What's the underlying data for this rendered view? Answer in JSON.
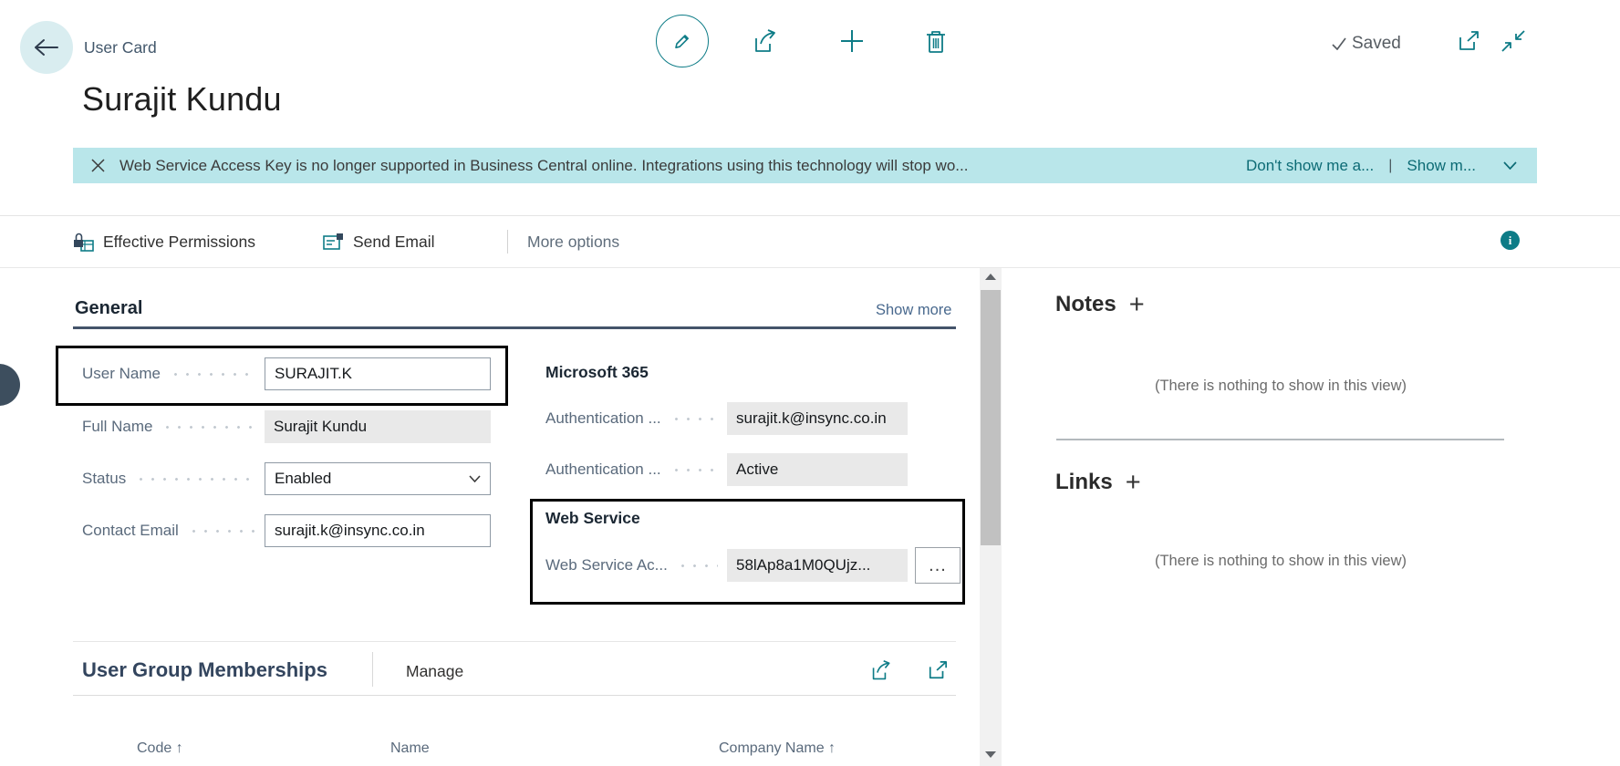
{
  "header": {
    "page_type": "User Card",
    "title": "Surajit Kundu",
    "saved_label": "Saved"
  },
  "banner": {
    "message": "Web Service Access Key is no longer supported in Business Central online. Integrations using this technology will stop wo...",
    "dismiss_link": "Don't show me a...",
    "separator": "|",
    "show_more_link": "Show m..."
  },
  "action_bar": {
    "effective_permissions": "Effective Permissions",
    "send_email": "Send Email",
    "more_options": "More options"
  },
  "general": {
    "heading": "General",
    "show_more": "Show more",
    "fields": {
      "user_name": {
        "label": "User Name",
        "value": "SURAJIT.K"
      },
      "full_name": {
        "label": "Full Name",
        "value": "Surajit Kundu"
      },
      "status": {
        "label": "Status",
        "value": "Enabled"
      },
      "contact_email": {
        "label": "Contact Email",
        "value": "surajit.k@insync.co.in"
      }
    },
    "microsoft365": {
      "heading": "Microsoft 365",
      "auth_email": {
        "label": "Authentication ...",
        "value": "surajit.k@insync.co.in"
      },
      "auth_status": {
        "label": "Authentication ...",
        "value": "Active"
      }
    },
    "web_service": {
      "heading": "Web Service",
      "access_key": {
        "label": "Web Service Ac...",
        "value": "58lAp8a1M0QUjz...",
        "assist": "..."
      }
    }
  },
  "memberships": {
    "heading": "User Group Memberships",
    "manage": "Manage",
    "columns": [
      "Code ↑",
      "Name",
      "Company Name ↑"
    ]
  },
  "factbox": {
    "notes": {
      "heading": "Notes",
      "plus": "+",
      "empty": "(There is nothing to show in this view)"
    },
    "links": {
      "heading": "Links",
      "plus": "+",
      "empty": "(There is nothing to show in this view)"
    }
  },
  "colors": {
    "accent_teal": "#0e7c87",
    "banner_background": "#b9e6ea",
    "section_underline": "#44546a",
    "readonly_background": "#e9e9e9",
    "highlight_border": "#000000"
  }
}
